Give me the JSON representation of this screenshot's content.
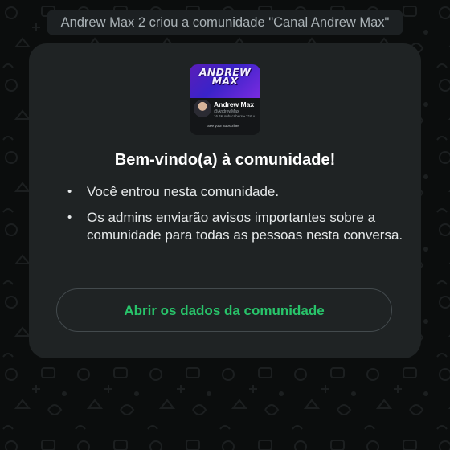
{
  "system_message": "Andrew Max 2 criou a comunidade \"Canal Andrew Max\"",
  "community_card": {
    "thumbnail": {
      "logo_text": "ANDREW\nMAX",
      "channel_name": "Andrew Max",
      "channel_handle": "@AndrewMax",
      "subscribers": "16.4K subscribers • 216 v",
      "cta_text": "See your subscriber"
    },
    "title": "Bem-vindo(a) à comunidade!",
    "bullets": [
      "Você entrou nesta comunidade.",
      "Os admins enviarão avisos importantes sobre a comunidade para todas as pessoas nesta conversa."
    ],
    "button_label": "Abrir os dados da comunidade"
  },
  "colors": {
    "background": "#0b0d0d",
    "card": "#1f2324",
    "accent_green": "#28c46a",
    "button_border": "#434a4d"
  }
}
